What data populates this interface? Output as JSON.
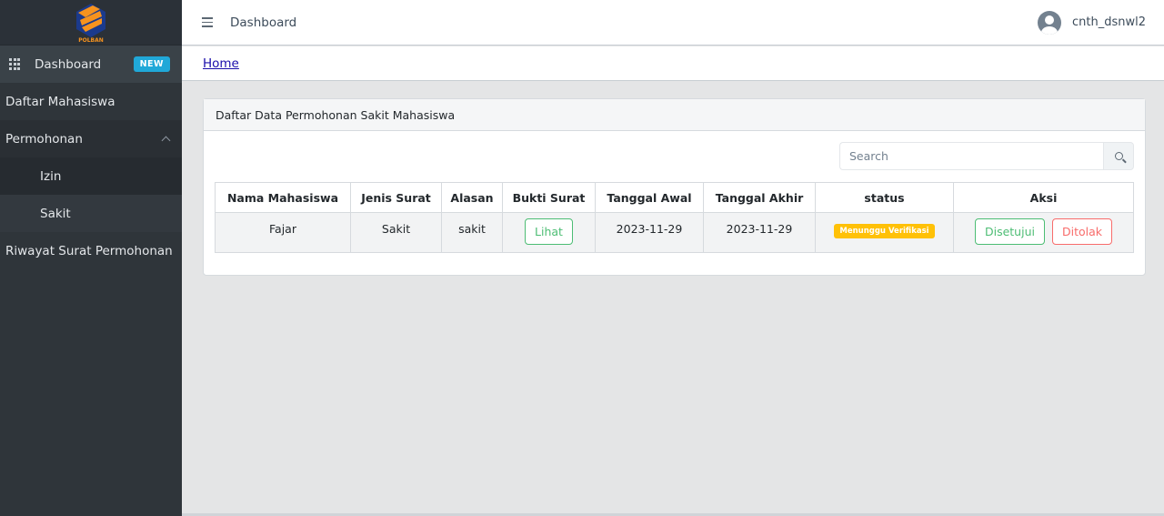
{
  "brand": {
    "logo_text": "POLBAN"
  },
  "sidebar": {
    "items": [
      {
        "label": "Dashboard",
        "badge": "NEW"
      },
      {
        "label": "Daftar Mahasiswa"
      },
      {
        "label": "Permohonan"
      },
      {
        "label": "Izin"
      },
      {
        "label": "Sakit"
      },
      {
        "label": "Riwayat Surat Permohonan"
      }
    ]
  },
  "header": {
    "title": "Dashboard",
    "username": "cnth_dsnwl2"
  },
  "breadcrumb": {
    "home": "Home"
  },
  "card": {
    "title": "Daftar Data Permohonan Sakit Mahasiswa",
    "search_placeholder": "Search",
    "columns": [
      "Nama Mahasiswa",
      "Jenis Surat",
      "Alasan",
      "Bukti Surat",
      "Tanggal Awal",
      "Tanggal Akhir",
      "status",
      "Aksi"
    ],
    "rows": [
      {
        "nama": "Fajar",
        "jenis": "Sakit",
        "alasan": "sakit",
        "bukti": "Lihat",
        "tanggal_awal": "2023-11-29",
        "tanggal_akhir": "2023-11-29",
        "status": "Menunggu Verifikasi",
        "approve": "Disetujui",
        "reject": "Ditolak"
      }
    ]
  },
  "colors": {
    "sidebar": "#2f353a",
    "accent": "#20a8d8",
    "success": "#4dbd74",
    "danger": "#f86c6b",
    "warning": "#ffc107"
  }
}
